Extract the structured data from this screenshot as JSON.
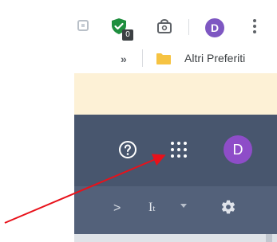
{
  "browser_toolbar": {
    "extension_badge": "0",
    "profile_initial": "D",
    "icons": [
      "extension-box-icon",
      "shield-check-icon",
      "shopping-bag-icon",
      "more-vert-icon"
    ]
  },
  "bookmarks_bar": {
    "chevron": "»",
    "folder_label": "Altri Preferiti",
    "folder_icon": "folder-icon"
  },
  "app_header": {
    "help_icon": "help-icon",
    "apps_icon": "apps-grid-icon",
    "avatar_initial": "D"
  },
  "sub_toolbar": {
    "chevron": ">",
    "text_format_main": "I",
    "text_format_sub": "t",
    "gear_icon": "gear-icon"
  },
  "colors": {
    "header": "#48566e",
    "sub_toolbar": "#53617a",
    "info_bar": "#fdf1d6",
    "avatar": "#8e4dc8",
    "annotation_arrow": "#e8111a"
  }
}
